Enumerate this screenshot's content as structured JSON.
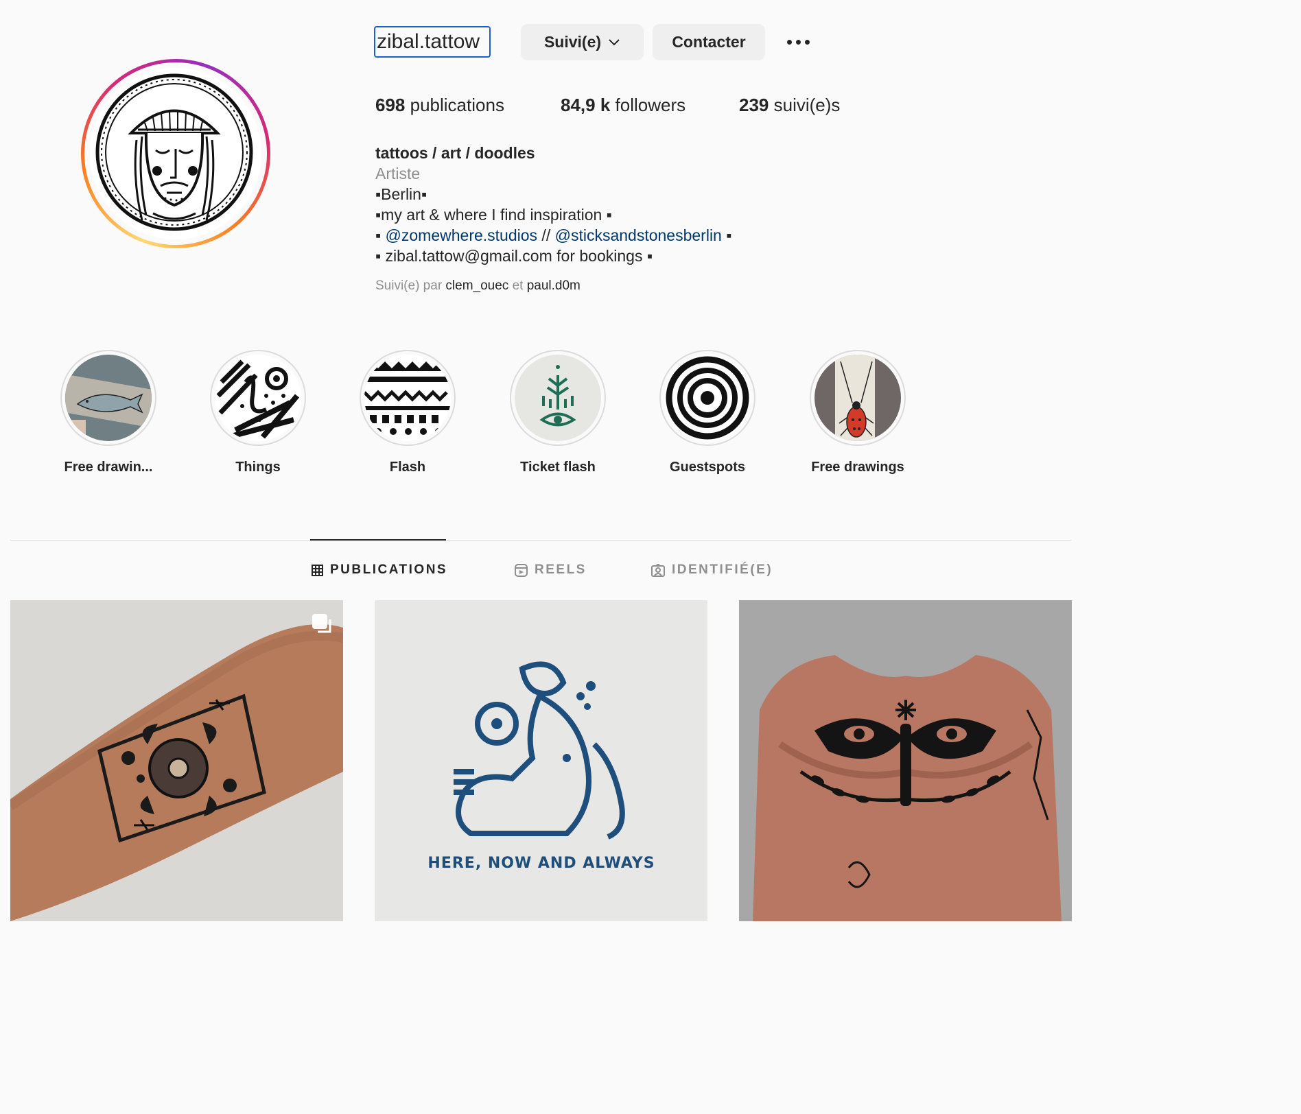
{
  "profile": {
    "username": "zibal.tattow",
    "follow_button": "Suivi(e)",
    "contact_button": "Contacter",
    "stats": {
      "posts_count": "698",
      "posts_label": "publications",
      "followers_count": "84,9 k",
      "followers_label": "followers",
      "following_count": "239",
      "following_label": "suivi(e)s"
    },
    "bio": {
      "name": "tattoos / art / doodles",
      "category": "Artiste",
      "line1": "▪Berlin▪",
      "line2": "▪my art & where I find inspiration ▪",
      "line3_prefix": "▪ ",
      "link1": "@zomewhere.studios",
      "line3_sep": " // ",
      "link2": "@sticksandstonesberlin",
      "line3_suffix": " ▪",
      "line4": "▪ zibal.tattow@gmail.com for bookings ▪"
    },
    "followed_by": {
      "prefix": "Suivi(e) par ",
      "user1": "clem_ouec",
      "conj": " et ",
      "user2": "paul.d0m"
    }
  },
  "highlights": [
    {
      "label": "Free drawin..."
    },
    {
      "label": "Things"
    },
    {
      "label": "Flash"
    },
    {
      "label": "Ticket flash"
    },
    {
      "label": "Guestspots"
    },
    {
      "label": "Free drawings"
    }
  ],
  "tabs": [
    {
      "label": "PUBLICATIONS",
      "icon": "grid-icon",
      "active": true
    },
    {
      "label": "REELS",
      "icon": "reels-icon",
      "active": false
    },
    {
      "label": "IDENTIFIÉ(E)",
      "icon": "tagged-icon",
      "active": false
    }
  ],
  "posts": [
    {
      "caption": ""
    },
    {
      "caption": "HERE, NOW AND ALWAYS"
    },
    {
      "caption": ""
    }
  ],
  "colors": {
    "link": "#00376b",
    "muted": "#8e8e8e",
    "focus": "#1a5fd0",
    "text": "#262626"
  }
}
